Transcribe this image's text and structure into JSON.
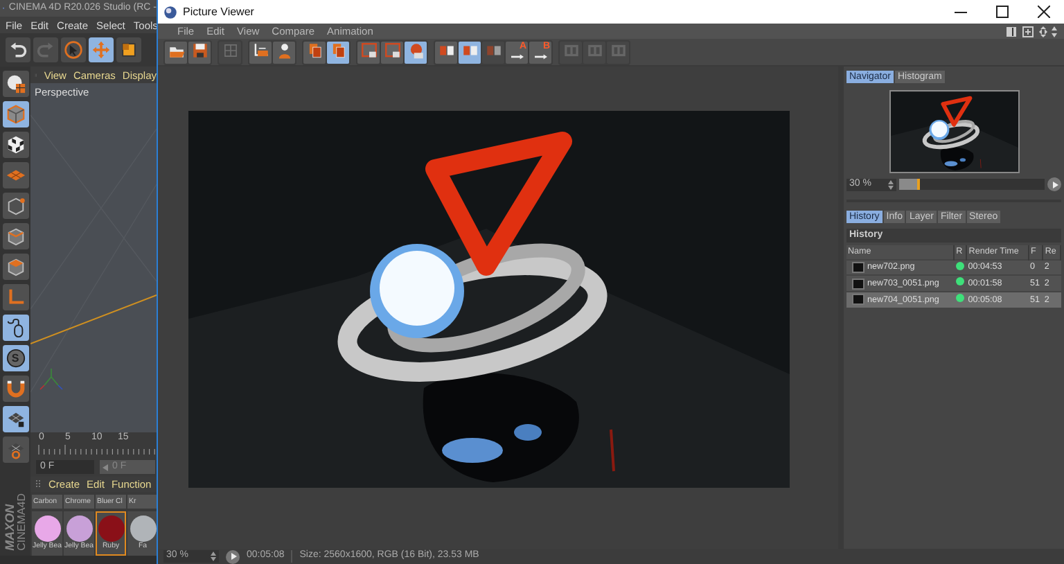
{
  "c4d": {
    "title": "CINEMA 4D R20.026 Studio (RC -",
    "menu": [
      "File",
      "Edit",
      "Create",
      "Select",
      "Tools"
    ],
    "tools": [
      {
        "kind": "undo",
        "selected": false
      },
      {
        "kind": "redo",
        "selected": false
      },
      {
        "kind": "select",
        "selected": false
      },
      {
        "kind": "move",
        "selected": true
      },
      {
        "kind": "scale",
        "selected": false
      }
    ],
    "side_tools": [
      {
        "kind": "sphere",
        "selected": false
      },
      {
        "kind": "cube",
        "selected": true
      },
      {
        "kind": "checker",
        "selected": false
      },
      {
        "kind": "plane",
        "selected": false
      },
      {
        "kind": "point",
        "selected": false
      },
      {
        "kind": "edge",
        "selected": false
      },
      {
        "kind": "face",
        "selected": false
      },
      {
        "kind": "axis",
        "selected": false
      },
      {
        "kind": "mouse",
        "selected": true
      },
      {
        "kind": "coin",
        "label": "S",
        "selected": true
      },
      {
        "kind": "magnet",
        "selected": false
      },
      {
        "kind": "gridlock",
        "selected": true
      },
      {
        "kind": "gridgear",
        "selected": false
      }
    ],
    "viewport": {
      "menu": [
        "View",
        "Cameras",
        "Display"
      ],
      "label": "Perspective"
    },
    "timeline": {
      "ticks": [
        "0",
        "5",
        "10",
        "15"
      ],
      "start_field": "0 F",
      "end_field": "0 F"
    },
    "materials": {
      "menu": [
        "Create",
        "Edit",
        "Function"
      ],
      "names_above": [
        "Carbon",
        "Chrome",
        "Bluer Cl",
        "Kr"
      ],
      "items": [
        {
          "name": "Jelly Bea",
          "color": "#e8a8e8",
          "selected": false
        },
        {
          "name": "Jelly Bea",
          "color": "#c8a0d8",
          "selected": false
        },
        {
          "name": "Ruby",
          "color": "#8a1018",
          "selected": true
        },
        {
          "name": "Fa",
          "color": "#b0b4b8",
          "selected": false
        }
      ]
    },
    "logo": [
      "MAXON",
      "CINEMA4D"
    ]
  },
  "viewer": {
    "title": "Picture Viewer",
    "menu": [
      "File",
      "Edit",
      "View",
      "Compare",
      "Animation"
    ],
    "toolbar": [
      [
        {
          "kind": "open",
          "active": false,
          "disabled": false
        },
        {
          "kind": "save",
          "active": false,
          "disabled": false
        }
      ],
      [
        {
          "kind": "grid",
          "active": false,
          "disabled": true
        }
      ],
      [
        {
          "kind": "crop",
          "active": false,
          "disabled": false
        },
        {
          "kind": "person",
          "active": false,
          "disabled": false
        }
      ],
      [
        {
          "kind": "copy",
          "active": false,
          "disabled": false
        },
        {
          "kind": "copy",
          "active": true,
          "disabled": false
        }
      ],
      [
        {
          "kind": "frame",
          "active": false,
          "disabled": false
        },
        {
          "kind": "frame",
          "active": false,
          "disabled": false
        },
        {
          "kind": "sphere",
          "active": true,
          "disabled": false
        }
      ],
      [
        {
          "kind": "split",
          "active": false,
          "disabled": false
        },
        {
          "kind": "split",
          "active": true,
          "disabled": false
        },
        {
          "kind": "split",
          "active": false,
          "disabled": true
        },
        {
          "kind": "arrow",
          "label": "A",
          "active": false,
          "disabled": false
        },
        {
          "kind": "arrow",
          "label": "B",
          "active": false,
          "disabled": false
        }
      ],
      [
        {
          "kind": "panel",
          "active": false,
          "disabled": true
        },
        {
          "kind": "panel",
          "active": false,
          "disabled": true
        },
        {
          "kind": "panel",
          "active": false,
          "disabled": true
        }
      ]
    ],
    "navigator": {
      "tabs": [
        {
          "label": "Navigator",
          "selected": true
        },
        {
          "label": "Histogram",
          "selected": false
        }
      ],
      "zoom": "30 %",
      "zoom_slider": {
        "level": 0.14
      }
    },
    "history": {
      "tabs": [
        {
          "label": "History",
          "selected": true
        },
        {
          "label": "Info",
          "selected": false
        },
        {
          "label": "Layer",
          "selected": false
        },
        {
          "label": "Filter",
          "selected": false
        },
        {
          "label": "Stereo",
          "selected": false
        }
      ],
      "title": "History",
      "columns": [
        "Name",
        "R",
        "Render Time",
        "F",
        "Re"
      ],
      "rows": [
        {
          "name": "new702.png",
          "color": "#3ee07a",
          "render_time": "00:04:53",
          "frame": "0",
          "column_5": "2",
          "selected": false
        },
        {
          "name": "new703_0051.png",
          "color": "#3ee07a",
          "render_time": "00:01:58",
          "frame": "51",
          "column_5": "2",
          "selected": false
        },
        {
          "name": "new704_0051.png",
          "color": "#3ee07a",
          "render_time": "00:05:08",
          "frame": "51",
          "column_5": "2",
          "selected": true
        }
      ]
    },
    "status_bar": {
      "zoom": "30 %",
      "time": "00:05:08",
      "info": "Size: 2560x1600, RGB (16 Bit), 23.53 MB"
    }
  }
}
